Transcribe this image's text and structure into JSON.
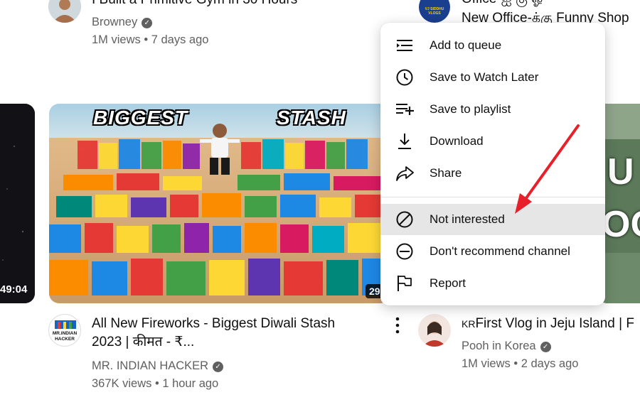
{
  "top_left": {
    "title": "I Built a Primitive Gym in 30 Hours",
    "channel": "Browney",
    "stats": "1M views • 7 days ago"
  },
  "top_right": {
    "title": "Office-ஐ கு ஓ",
    "title2": "New Office-க்கு Funny Shop",
    "avatar_text": "VJ SIDDHU VLOGS"
  },
  "left_partial": {
    "duration": "49:04"
  },
  "main_video": {
    "thumb_text_left": "BIGGEST",
    "thumb_text_right": "STASH",
    "duration": "29",
    "title_line1": "All New Fireworks - Biggest Diwali Stash",
    "title_line2": "2023 | कीमत - ₹...",
    "channel": "MR. INDIAN HACKER",
    "stats": "367K views • 1 hour ago",
    "avatar_text": "MR.INDIAN HACKER"
  },
  "right_video": {
    "thumb_text_1": "U",
    "thumb_text_2": "OG",
    "title_prefix": "KR",
    "title": "First Vlog in Jeju Island | F",
    "channel": "Pooh in Korea",
    "stats": "1M views • 2 days ago"
  },
  "menu": {
    "items": [
      {
        "label": "Add to queue",
        "icon": "add-to-queue-icon"
      },
      {
        "label": "Save to Watch Later",
        "icon": "clock-icon"
      },
      {
        "label": "Save to playlist",
        "icon": "playlist-add-icon"
      },
      {
        "label": "Download",
        "icon": "download-icon"
      },
      {
        "label": "Share",
        "icon": "share-icon"
      },
      {
        "label": "Not interested",
        "icon": "not-interested-icon"
      },
      {
        "label": "Don't recommend channel",
        "icon": "remove-circle-icon"
      },
      {
        "label": "Report",
        "icon": "flag-icon"
      }
    ],
    "highlighted_index": 5
  },
  "colors": {
    "annotation_arrow": "#e8202a",
    "menu_highlight": "#e6e6e6",
    "secondary_text": "#606060"
  }
}
